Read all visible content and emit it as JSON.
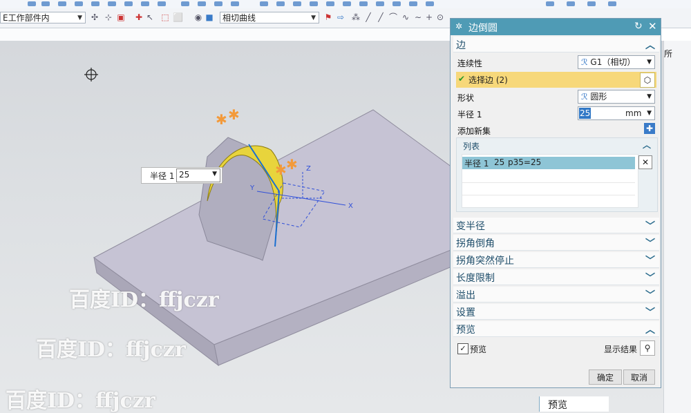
{
  "toolbar": {
    "scope_select": "E工作部件内",
    "curve_rule_select": "相切曲线"
  },
  "viewport": {
    "floating_label": "半径 1",
    "floating_value": "25",
    "axis_x": "X",
    "axis_y": "Y",
    "axis_z": "Z",
    "watermark": "百度ID：ffjczr"
  },
  "dialog": {
    "title": "边倒圆",
    "sections": {
      "edge": "边",
      "list": "列表",
      "variable_radius": "变半径",
      "corner_setback": "拐角倒角",
      "stop_short": "拐角突然停止",
      "length_limit": "长度限制",
      "overflow": "溢出",
      "settings": "设置",
      "preview": "预览"
    },
    "continuity_label": "连续性",
    "continuity_value": "G1（相切）",
    "select_edge": "选择边 (2)",
    "shape_label": "形状",
    "shape_value": "圆形",
    "radius_label": "半径 1",
    "radius_value": "25",
    "radius_unit": "mm",
    "add_new_set": "添加新集",
    "list_row": [
      "半径 1",
      "25",
      "p35=25"
    ],
    "preview_checkbox": "预览",
    "show_result": "显示结果",
    "ok_button": "确定",
    "cancel_button": "取消"
  },
  "right_panel": {
    "col_label": "所",
    "bottom_label": "预览"
  },
  "colors": {
    "title_bar": "#4f9bb5",
    "selection_highlight": "#f7d87a",
    "list_row": "#8ec5d6",
    "fillet_yellow": "#e8d43c",
    "handle_orange": "#f39a3a"
  }
}
